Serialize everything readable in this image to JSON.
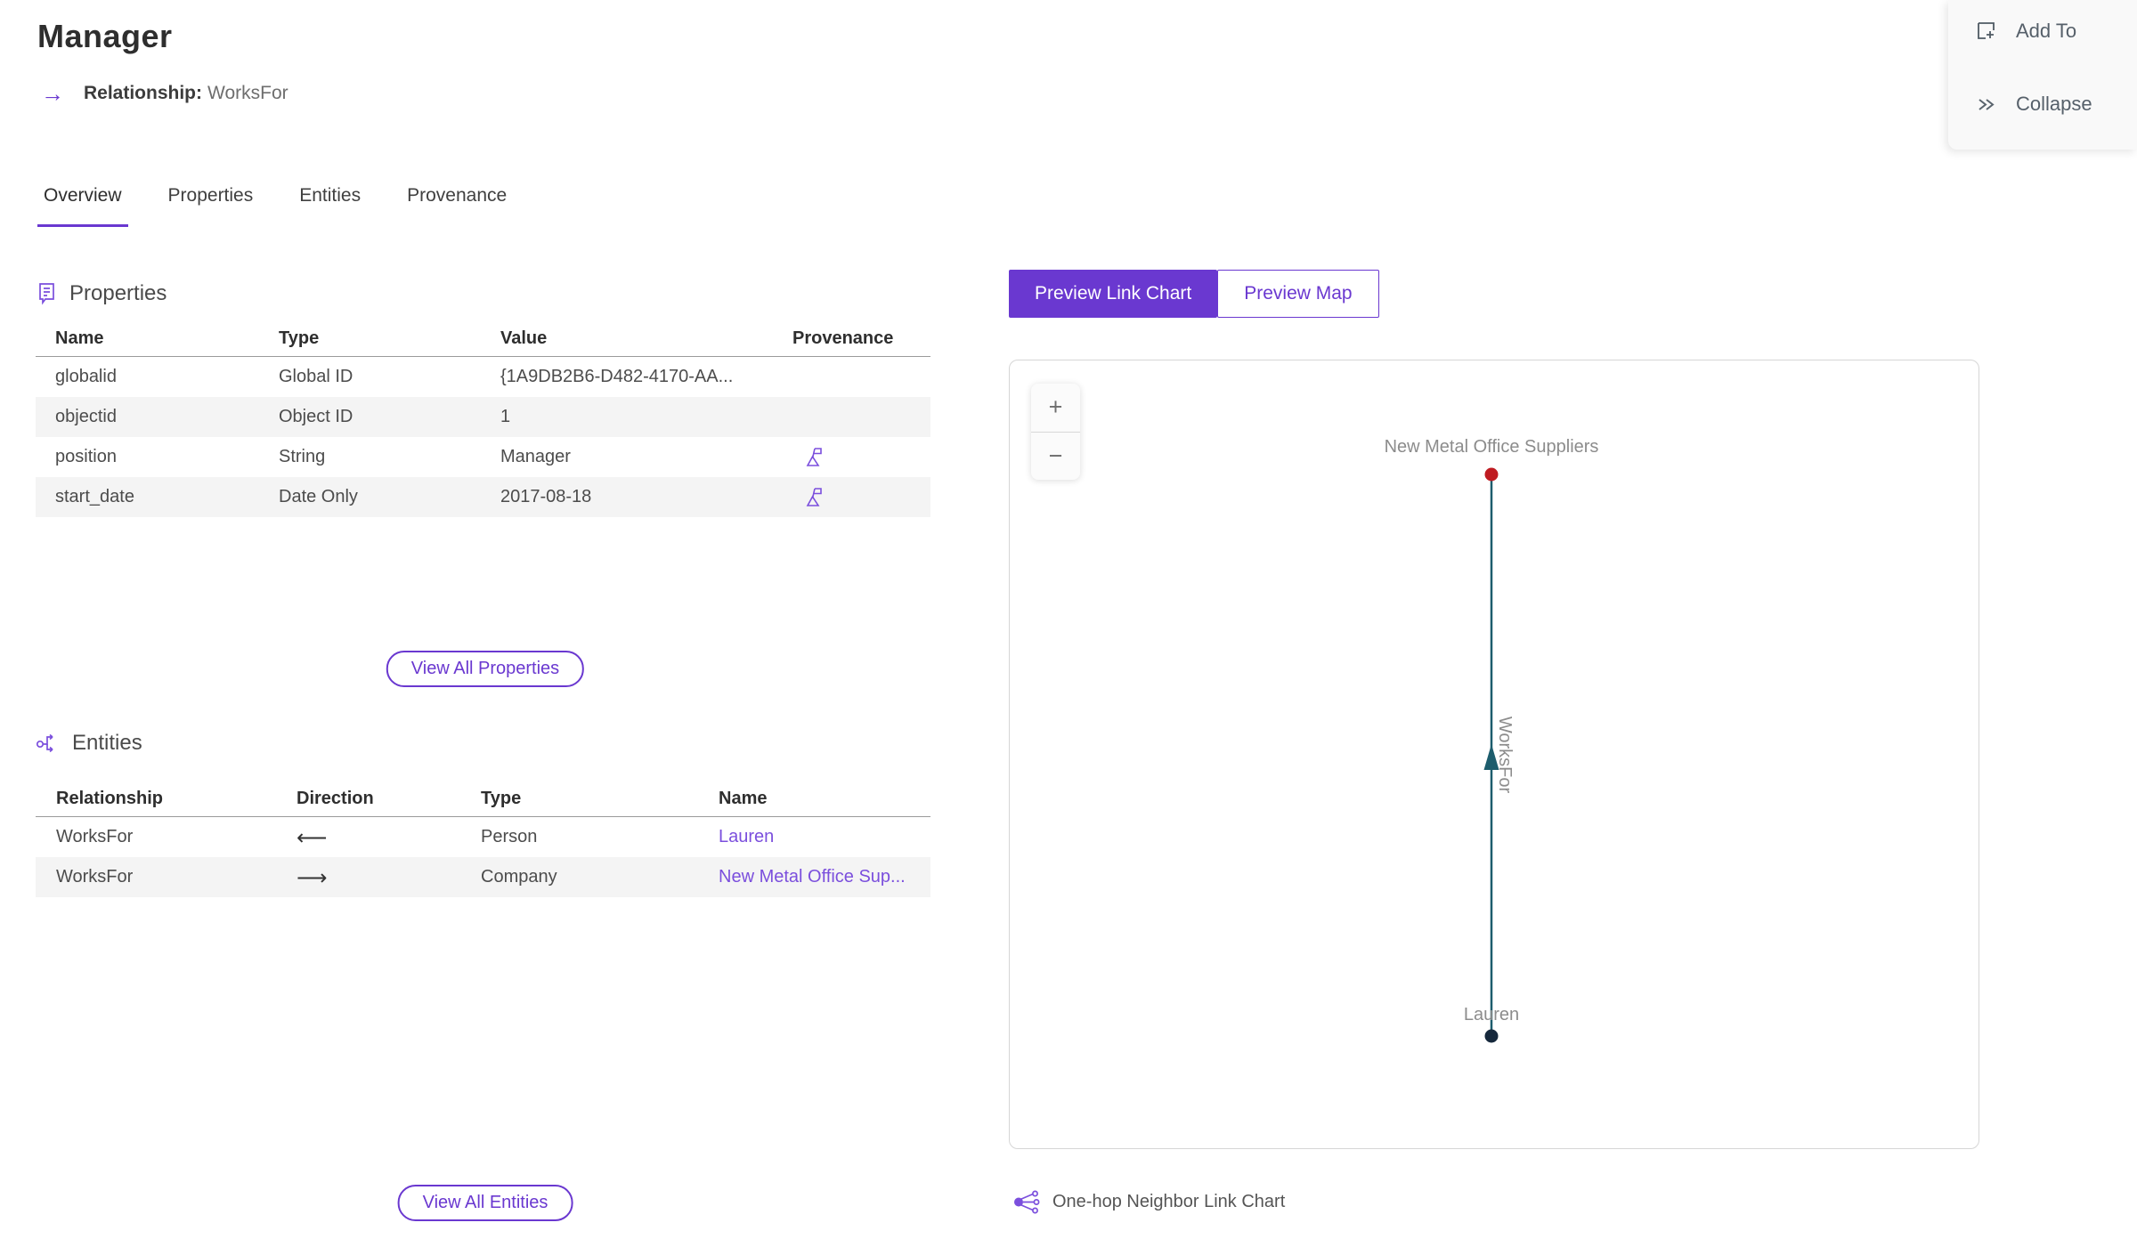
{
  "colors": {
    "accent_purple": "#6a38d0",
    "link_purple": "#7b4fdd",
    "edge_teal": "#1d5d6d",
    "node_red": "#bf1b21",
    "node_navy": "#16283c",
    "row_alt_bg": "#f4f4f4",
    "chart_label_gray": "#8c8c8c"
  },
  "header": {
    "title": "Manager",
    "subtitle_label": "Relationship:",
    "subtitle_value": "WorksFor"
  },
  "actions": {
    "add_to": "Add To",
    "collapse": "Collapse"
  },
  "tabs": [
    {
      "label": "Overview",
      "active": true
    },
    {
      "label": "Properties",
      "active": false
    },
    {
      "label": "Entities",
      "active": false
    },
    {
      "label": "Provenance",
      "active": false
    }
  ],
  "properties_section": {
    "title": "Properties",
    "columns": [
      "Name",
      "Type",
      "Value",
      "Provenance"
    ],
    "rows": [
      {
        "name": "globalid",
        "type": "Global ID",
        "value": "{1A9DB2B6-D482-4170-AA...",
        "has_provenance": false
      },
      {
        "name": "objectid",
        "type": "Object ID",
        "value": "1",
        "has_provenance": false
      },
      {
        "name": "position",
        "type": "String",
        "value": "Manager",
        "has_provenance": true
      },
      {
        "name": "start_date",
        "type": "Date Only",
        "value": "2017-08-18",
        "has_provenance": true
      }
    ],
    "view_all": "View All Properties"
  },
  "entities_section": {
    "title": "Entities",
    "columns": [
      "Relationship",
      "Direction",
      "Type",
      "Name"
    ],
    "rows": [
      {
        "relationship": "WorksFor",
        "direction": "⟵",
        "type": "Person",
        "name": "Lauren"
      },
      {
        "relationship": "WorksFor",
        "direction": "⟶",
        "type": "Company",
        "name": "New Metal Office Sup..."
      }
    ],
    "view_all": "View All Entities"
  },
  "preview": {
    "link_chart_tab": "Preview Link Chart",
    "map_tab": "Preview Map",
    "zoom_in": "+",
    "zoom_out": "−",
    "footer": "One-hop Neighbor Link Chart"
  },
  "chart_data": {
    "type": "link-chart",
    "nodes": [
      {
        "id": "company",
        "label": "New Metal Office Suppliers",
        "color": "#bf1b21"
      },
      {
        "id": "person",
        "label": "Lauren",
        "color": "#16283c"
      }
    ],
    "edges": [
      {
        "label": "WorksFor",
        "from": "person",
        "to": "company",
        "color": "#1d5d6d",
        "arrow_direction": "up"
      }
    ]
  }
}
